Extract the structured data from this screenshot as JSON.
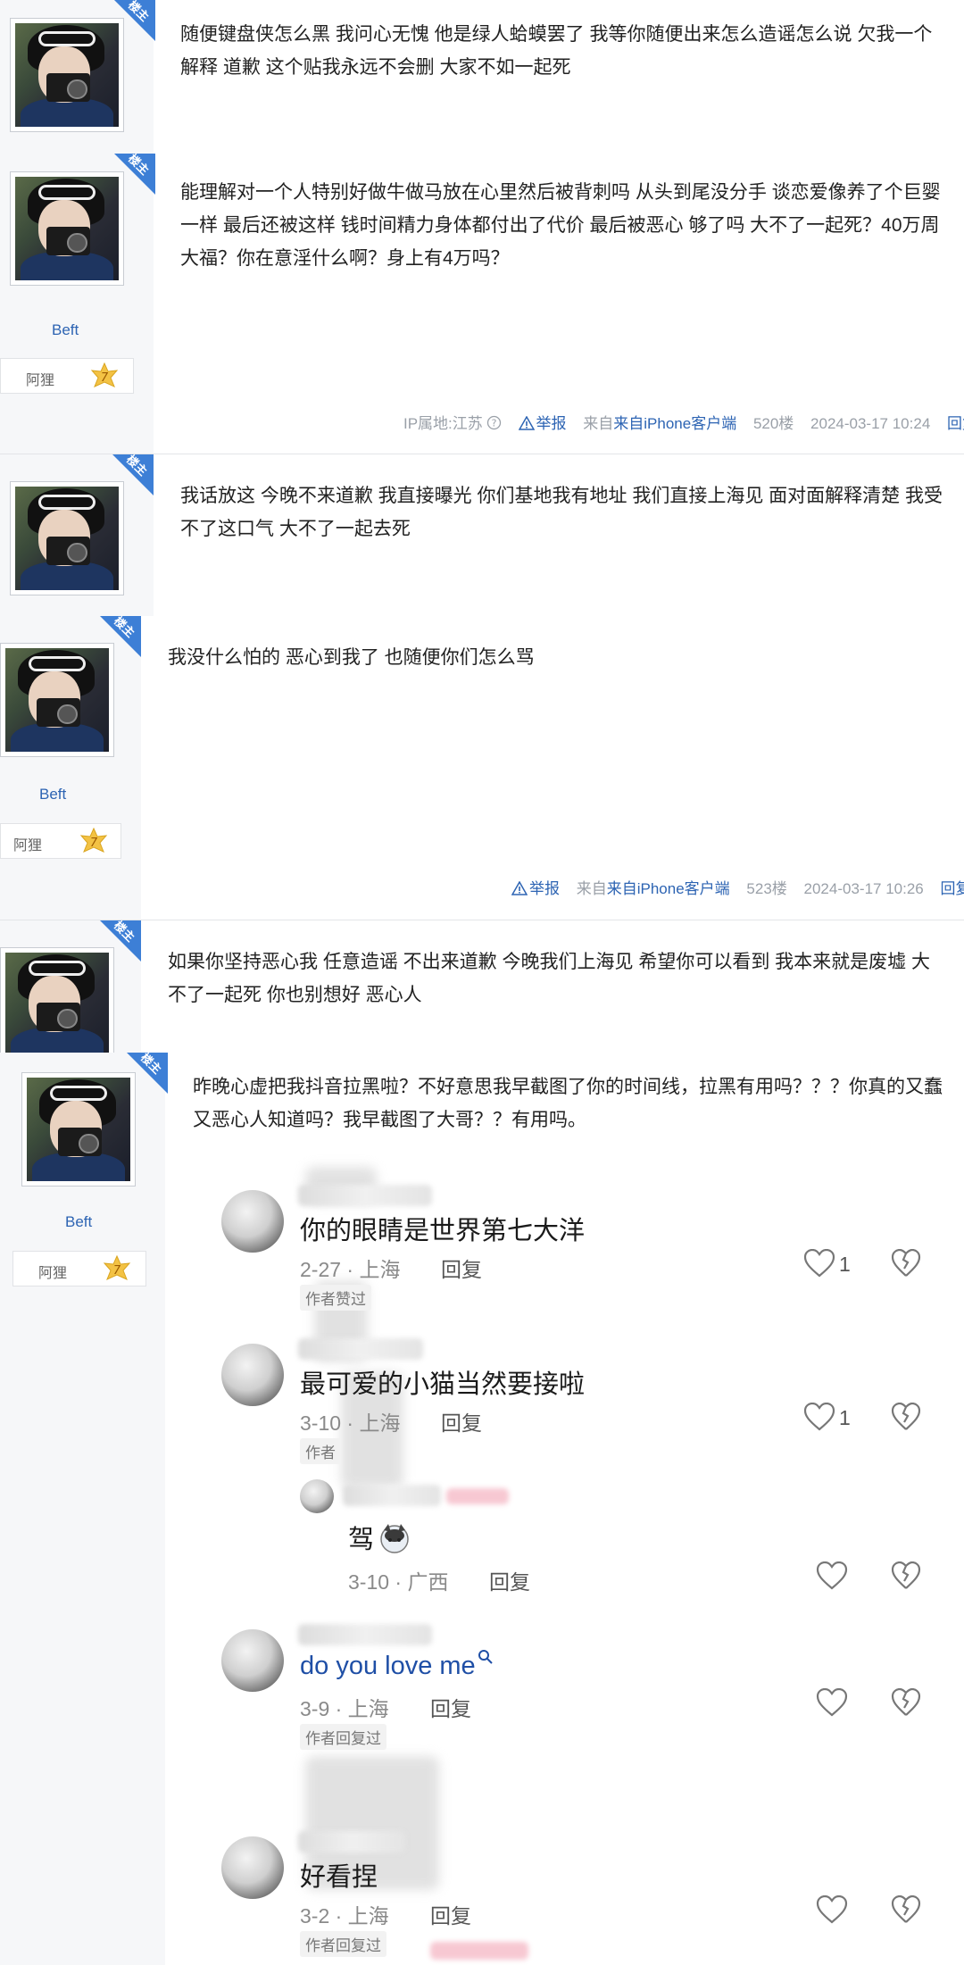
{
  "colors": {
    "accent_blue": "#2d64b3",
    "badge_blue": "#3d7fd6",
    "meta_grey": "#9aa0a8"
  },
  "common": {
    "louzhu_badge": "楼主",
    "username": "Beft",
    "level_name": "阿狸",
    "level_num": "7",
    "report": "举报",
    "reply": "回复",
    "help_icon": "question-circle-icon",
    "warn_icon": "warning-triangle-icon"
  },
  "posts": [
    {
      "text": "随便键盘侠怎么黑 我问心无愧 他是绿人蛤蟆罢了 我等你随便出来怎么造谣怎么说 欠我一个解释 道歉 这个贴我永远不会删 大家不如一起死"
    },
    {
      "text": "能理解对一个人特别好做牛做马放在心里然后被背刺吗 从头到尾没分手 谈恋爱像养了个巨婴一样 最后还被这样 钱时间精力身体都付出了代价 最后被恶心 够了吗 大不了一起死？40万周大福？你在意淫什么啊？身上有4万吗？",
      "ip": "IP属地:江苏",
      "source": "来自iPhone客户端",
      "floor": "520楼",
      "time": "2024-03-17 10:24"
    },
    {
      "text": "我话放这 今晚不来道歉 我直接曝光 你们基地我有地址 我们直接上海见 面对面解释清楚 我受不了这口气 大不了一起去死"
    },
    {
      "text": "我没什么怕的 恶心到我了 也随便你们怎么骂",
      "source": "来自iPhone客户端",
      "floor": "523楼",
      "time": "2024-03-17 10:26"
    },
    {
      "text": "如果你坚持恶心我 任意造谣 不出来道歉 今晚我们上海见 希望你可以看到 我本来就是废墟 大不了一起死 你也别想好 恶心人"
    },
    {
      "text": "昨晚心虚把我抖音拉黑啦？不好意思我早截图了你的时间线，拉黑有用吗？？？你真的又蠢又恶心人知道吗？我早截图了大哥？？有用吗。"
    }
  ],
  "screenshot_comments": [
    {
      "text": "你的眼睛是世界第七大洋",
      "meta": "2-27 · 上海",
      "reply": "回复",
      "likes": "1",
      "tag": "作者赞过"
    },
    {
      "text": "最可爱的小猫当然要接啦",
      "meta": "3-10 · 上海",
      "reply": "回复",
      "likes": "1",
      "tag": "作者"
    },
    {
      "text": "驾",
      "meta": "3-10 · 广西",
      "reply": "回复",
      "likes": "",
      "tag": ""
    },
    {
      "text": "do you love me",
      "meta": "3-9 · 上海",
      "reply": "回复",
      "likes": "",
      "tag": "作者回复过"
    },
    {
      "text": "好看捏",
      "meta": "3-2 · 上海",
      "reply": "回复",
      "likes": "",
      "tag": "作者回复过"
    }
  ]
}
